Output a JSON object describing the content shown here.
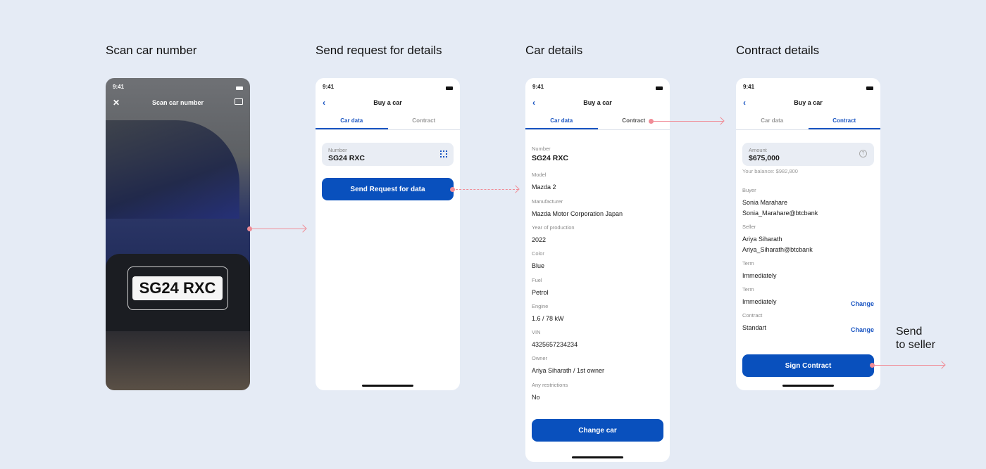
{
  "steps": [
    "Scan car number",
    "Send request for details",
    "Car details",
    "Contract details"
  ],
  "status_time": "9:41",
  "scan": {
    "title": "Scan car number",
    "plate": "SG24 RXC"
  },
  "common": {
    "nav_title": "Buy a car",
    "tab_car": "Car data",
    "tab_contract": "Contract"
  },
  "request": {
    "number_label": "Number",
    "number_value": "SG24 RXC",
    "button": "Send Request for data"
  },
  "car": {
    "fields": [
      {
        "label": "Number",
        "value": "SG24 RXC"
      },
      {
        "label": "Model",
        "value": "Mazda 2"
      },
      {
        "label": "Manufacturer",
        "value": "Mazda Motor Corporation Japan"
      },
      {
        "label": "Year of production",
        "value": "2022"
      },
      {
        "label": "Color",
        "value": "Blue"
      },
      {
        "label": "Fuel",
        "value": "Petrol"
      },
      {
        "label": "Engine",
        "value": "1.6 / 78 kW"
      },
      {
        "label": "VIN",
        "value": "4325657234234"
      },
      {
        "label": "Owner",
        "value": "Ariya Siharath / 1st owner"
      },
      {
        "label": "Any restrictions",
        "value": "No"
      }
    ],
    "button": "Change car"
  },
  "contract": {
    "amount_label": "Amount",
    "amount_value": "$675,000",
    "balance": "Your balance: $982,800",
    "buyer_label": "Buyer",
    "buyer_name": "Sonia Marahare",
    "buyer_email": "Sonia_Marahare@btcbank",
    "seller_label": "Seller",
    "seller_name": "Ariya Siharath",
    "seller_email": "Ariya_Siharath@btcbank",
    "term1_label": "Term",
    "term1_value": "Immediately",
    "term2_label": "Term",
    "term2_value": "Immediately",
    "contract_label": "Contract",
    "contract_value": "Standart",
    "change": "Change",
    "button": "Sign Contract"
  },
  "send_note": "Send\nto seller",
  "colors": {
    "accent": "#0950bd",
    "background": "#e5ebf5",
    "arrow": "#f08c96"
  }
}
